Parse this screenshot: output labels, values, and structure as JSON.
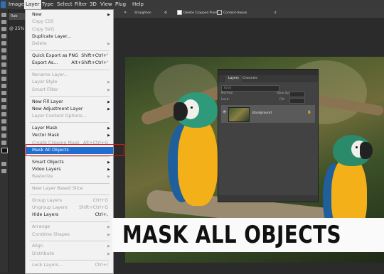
{
  "menubar": {
    "items": [
      "Image",
      "Layer",
      "Type",
      "Select",
      "Filter",
      "3D",
      "View",
      "Plug",
      "Help"
    ],
    "active": "Layer"
  },
  "options_bar": {
    "straighten": "Straighten",
    "delete_cropped": "Delete Cropped Pixels",
    "content_aware": "Content-Aware"
  },
  "document": {
    "tab": "Rab",
    "zoom": "@ 25%"
  },
  "layer_menu": {
    "items": [
      {
        "label": "New",
        "shortcut": "",
        "submenu": true,
        "disabled": false
      },
      {
        "label": "Copy CSS",
        "shortcut": "",
        "submenu": false,
        "disabled": true
      },
      {
        "label": "Copy SVG",
        "shortcut": "",
        "submenu": false,
        "disabled": true
      },
      {
        "label": "Duplicate Layer...",
        "shortcut": "",
        "submenu": false,
        "disabled": false
      },
      {
        "label": "Delete",
        "shortcut": "",
        "submenu": true,
        "disabled": true
      },
      {
        "label": "Quick Export as PNG",
        "shortcut": "Shift+Ctrl+'",
        "submenu": false,
        "disabled": false
      },
      {
        "label": "Export As...",
        "shortcut": "Alt+Shift+Ctrl+'",
        "submenu": false,
        "disabled": false
      },
      {
        "label": "Rename Layer...",
        "shortcut": "",
        "submenu": false,
        "disabled": true
      },
      {
        "label": "Layer Style",
        "shortcut": "",
        "submenu": true,
        "disabled": true
      },
      {
        "label": "Smart Filter",
        "shortcut": "",
        "submenu": true,
        "disabled": true
      },
      {
        "label": "New Fill Layer",
        "shortcut": "",
        "submenu": true,
        "disabled": false
      },
      {
        "label": "New Adjustment Layer",
        "shortcut": "",
        "submenu": true,
        "disabled": false
      },
      {
        "label": "Layer Content Options...",
        "shortcut": "",
        "submenu": false,
        "disabled": true
      },
      {
        "label": "Layer Mask",
        "shortcut": "",
        "submenu": true,
        "disabled": false
      },
      {
        "label": "Vector Mask",
        "shortcut": "",
        "submenu": true,
        "disabled": false
      },
      {
        "label": "Create Clipping Mask",
        "shortcut": "Alt+Ctrl+G",
        "submenu": false,
        "disabled": true
      },
      {
        "label": "Mask All Objects",
        "shortcut": "",
        "submenu": false,
        "disabled": false,
        "highlighted": true
      },
      {
        "label": "Smart Objects",
        "shortcut": "",
        "submenu": true,
        "disabled": false
      },
      {
        "label": "Video Layers",
        "shortcut": "",
        "submenu": true,
        "disabled": false
      },
      {
        "label": "Rasterize",
        "shortcut": "",
        "submenu": true,
        "disabled": true
      },
      {
        "label": "New Layer Based Slice",
        "shortcut": "",
        "submenu": false,
        "disabled": true
      },
      {
        "label": "Group Layers",
        "shortcut": "Ctrl+G",
        "submenu": false,
        "disabled": true
      },
      {
        "label": "Ungroup Layers",
        "shortcut": "Shift+Ctrl+G",
        "submenu": false,
        "disabled": true
      },
      {
        "label": "Hide Layers",
        "shortcut": "Ctrl+,",
        "submenu": false,
        "disabled": false
      },
      {
        "label": "Arrange",
        "shortcut": "",
        "submenu": true,
        "disabled": true
      },
      {
        "label": "Combine Shapes",
        "shortcut": "",
        "submenu": true,
        "disabled": true
      },
      {
        "label": "Align",
        "shortcut": "",
        "submenu": true,
        "disabled": true
      },
      {
        "label": "Distribute",
        "shortcut": "",
        "submenu": true,
        "disabled": true
      },
      {
        "label": "Lock Layers...",
        "shortcut": "Ctrl+/",
        "submenu": false,
        "disabled": true
      }
    ]
  },
  "layers_panel": {
    "tabs": [
      "Layers",
      "Channels"
    ],
    "active_tab": "Layers",
    "search_placeholder": "Kind",
    "blend_mode": "Normal",
    "opacity_label": "Opacity:",
    "lock_label": "Lock:",
    "fill_label": "Fill:",
    "layer_name": "Background"
  },
  "banner": {
    "text": "MASK ALL OBJECTS"
  },
  "colors": {
    "highlight": "#1e6fd0",
    "callout": "#e01414",
    "menu_bg": "#f2f2f2"
  },
  "icons": [
    "photoshop-logo-icon",
    "crop-icon",
    "gear-icon",
    "undo-icon",
    "eye-icon",
    "lock-icon",
    "chevron-right-icon"
  ]
}
